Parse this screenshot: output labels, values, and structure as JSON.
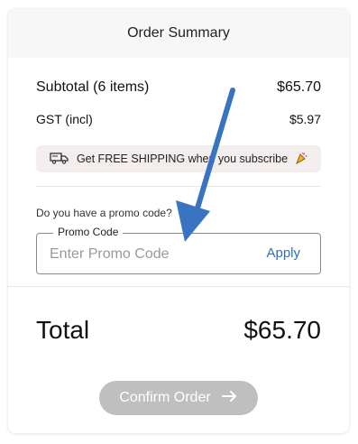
{
  "header": {
    "title": "Order Summary"
  },
  "summary": {
    "subtotal_label": "Subtotal (6 items)",
    "subtotal_value": "$65.70",
    "gst_label": "GST (incl)",
    "gst_value": "$5.97"
  },
  "banner": {
    "text": "Get FREE SHIPPING when you subscribe",
    "icon_left": "truck-icon",
    "icon_right": "party-popper-icon"
  },
  "promo": {
    "question": "Do you have a promo code?",
    "legend": "Promo Code",
    "placeholder": "Enter Promo Code",
    "apply_label": "Apply"
  },
  "total": {
    "label": "Total",
    "value": "$65.70"
  },
  "confirm": {
    "label": "Confirm Order",
    "icon": "arrow-right-icon"
  },
  "colors": {
    "accent": "#2b6dc4",
    "banner_bg": "#f4eded",
    "disabled_button": "#bfbfbf",
    "annotation_arrow": "#3a73c2"
  }
}
